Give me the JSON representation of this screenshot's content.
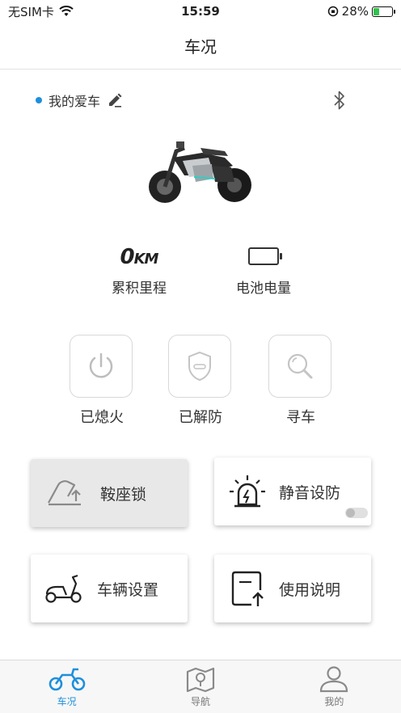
{
  "status_bar": {
    "carrier": "无SIM卡",
    "time": "15:59",
    "battery_percent": "28%",
    "battery_level": 0.28
  },
  "header": {
    "title": "车况"
  },
  "vehicle": {
    "name": "我的爱车"
  },
  "stats": {
    "mileage_value": "0",
    "mileage_unit": "KM",
    "mileage_label": "累积里程",
    "battery_label": "电池电量"
  },
  "controls": [
    {
      "label": "已熄火",
      "icon": "power-icon"
    },
    {
      "label": "已解防",
      "icon": "shield-icon"
    },
    {
      "label": "寻车",
      "icon": "search-icon"
    }
  ],
  "cards": [
    {
      "label": "鞍座锁",
      "icon": "seat-lock-icon"
    },
    {
      "label": "静音设防",
      "icon": "alarm-light-icon",
      "toggle_on": false
    },
    {
      "label": "车辆设置",
      "icon": "scooter-icon"
    },
    {
      "label": "使用说明",
      "icon": "manual-icon"
    }
  ],
  "tabs": [
    {
      "label": "车况",
      "icon": "motorcycle-icon",
      "active": true
    },
    {
      "label": "导航",
      "icon": "map-icon",
      "active": false
    },
    {
      "label": "我的",
      "icon": "user-icon",
      "active": false
    }
  ],
  "colors": {
    "accent": "#1e8fdc",
    "battery_green": "#33c24d"
  }
}
